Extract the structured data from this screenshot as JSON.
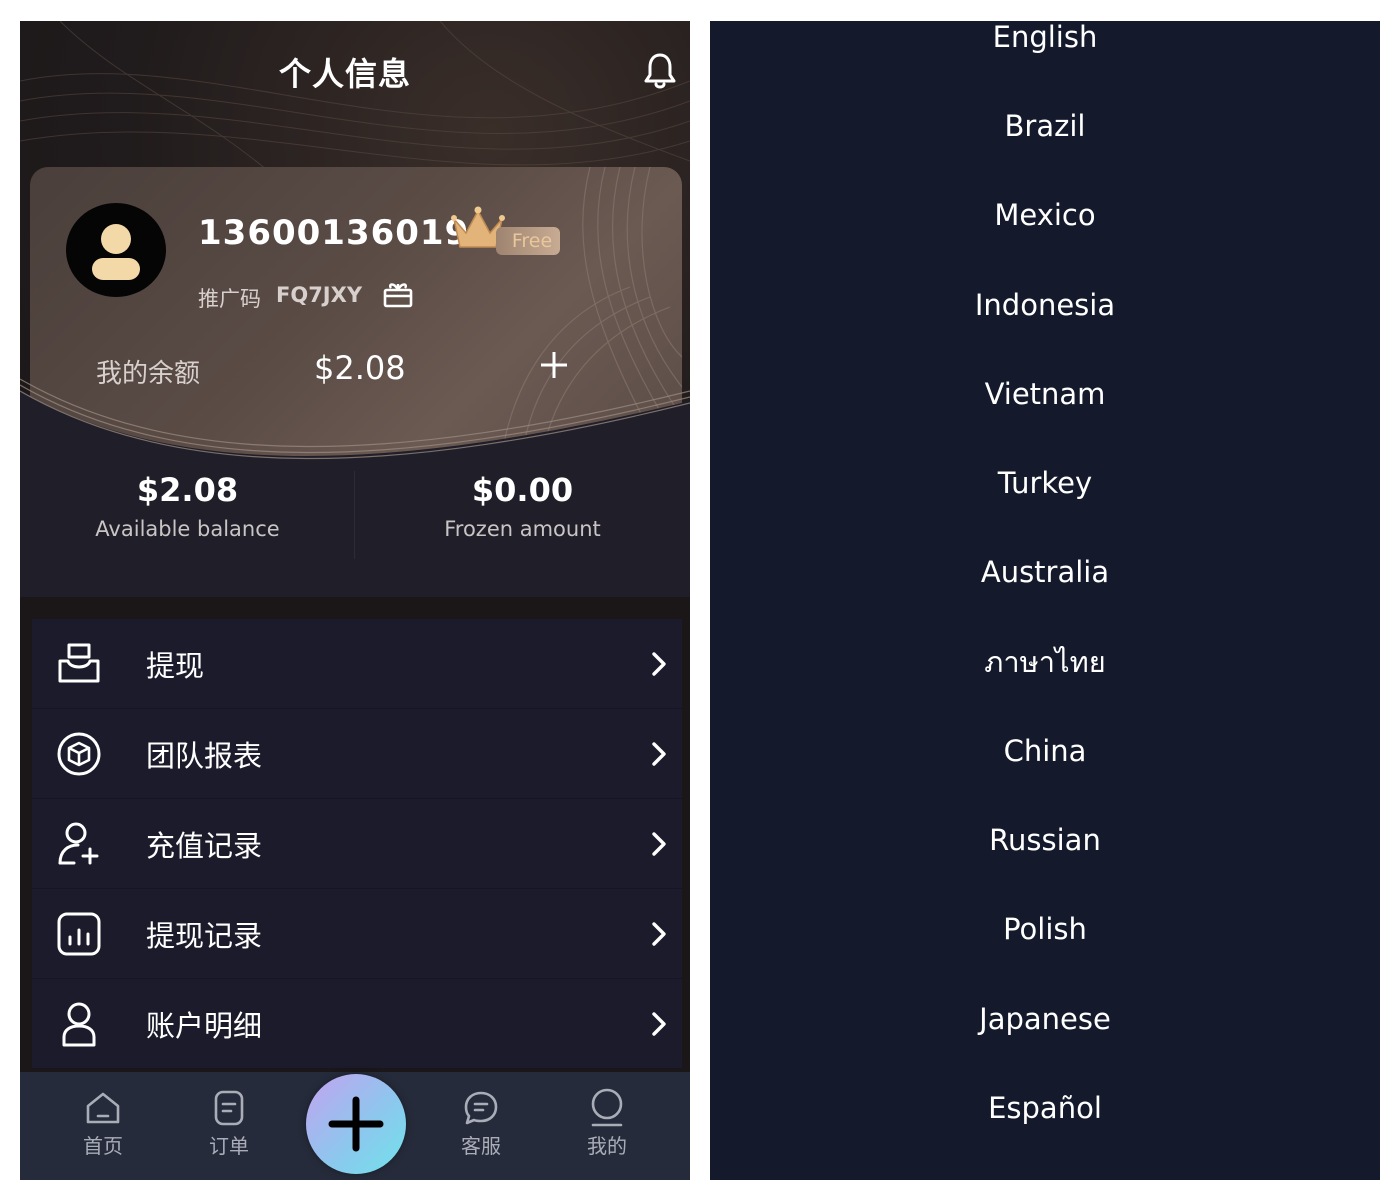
{
  "header": {
    "title": "个人信息"
  },
  "profile": {
    "phone_number": "13600136019",
    "membership_badge": "Free",
    "promo_label": "推广码",
    "promo_code": "FQ7JXY",
    "balance_label": "我的余额",
    "balance_value": "$2.08"
  },
  "stats": {
    "available_value": "$2.08",
    "available_label": "Available balance",
    "frozen_value": "$0.00",
    "frozen_label": "Frozen amount"
  },
  "menu": {
    "items": [
      {
        "label": "提现",
        "icon": "inbox-icon"
      },
      {
        "label": "团队报表",
        "icon": "cube-icon"
      },
      {
        "label": "充值记录",
        "icon": "user-add-icon"
      },
      {
        "label": "提现记录",
        "icon": "bar-chart-icon"
      },
      {
        "label": "账户明细",
        "icon": "user-icon"
      }
    ]
  },
  "tabbar": {
    "home": "首页",
    "orders": "订单",
    "support": "客服",
    "mine": "我的"
  },
  "languages": [
    "English",
    "Brazil",
    "Mexico",
    "Indonesia",
    "Vietnam",
    "Turkey",
    "Australia",
    "ภาษาไทย",
    "China",
    "Russian",
    "Polish",
    "Japanese",
    "Español"
  ],
  "colors": {
    "accent_fab_start": "#c3a3f0",
    "accent_fab_end": "#6fe3ea",
    "menu_bg": "#1b1b2b",
    "lang_bg": "#141a2c",
    "badge_text": "#e9c69b"
  }
}
